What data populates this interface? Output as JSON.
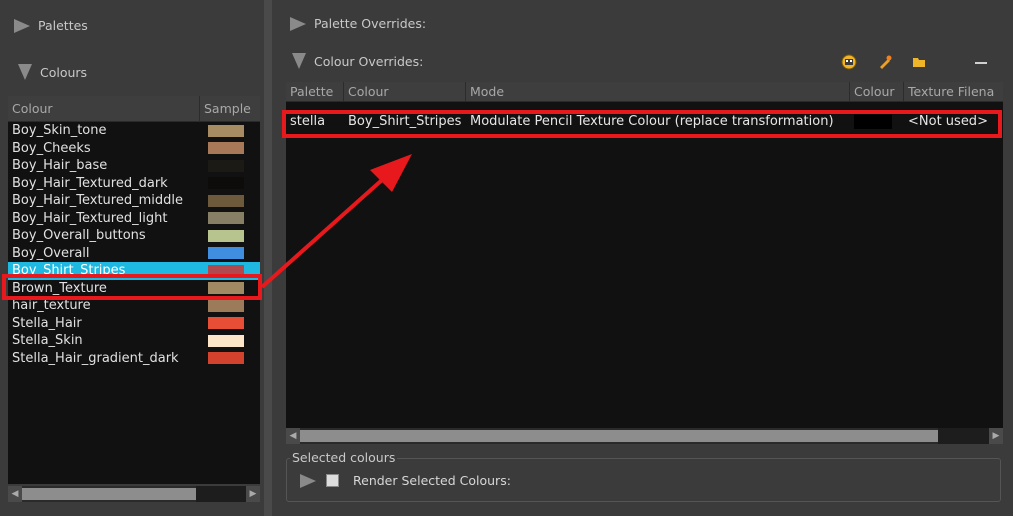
{
  "left": {
    "palettes_label": "Palettes",
    "colours_label": "Colours",
    "table_headers": {
      "colour": "Colour",
      "sample": "Sample"
    },
    "colours": [
      {
        "name": "Boy_Skin_tone",
        "swatch": "#a78b63"
      },
      {
        "name": "Boy_Cheeks",
        "swatch": "#a87958"
      },
      {
        "name": "Boy_Hair_base",
        "swatch": "#1c1a15"
      },
      {
        "name": "Boy_Hair_Textured_dark",
        "swatch": "#0d0c0a"
      },
      {
        "name": "Boy_Hair_Textured_middle",
        "swatch": "#6d5a3d"
      },
      {
        "name": "Boy_Hair_Textured_light",
        "swatch": "#867f65"
      },
      {
        "name": "Boy_Overall_buttons",
        "swatch": "#b8c48e"
      },
      {
        "name": "Boy_Overall",
        "swatch": "#3f8ee0"
      },
      {
        "name": "Boy_Shirt_Stripes",
        "swatch": "#b04a4e",
        "selected": true
      },
      {
        "name": "Brown_Texture",
        "swatch": "#a18a63"
      },
      {
        "name": "hair_texture",
        "swatch": "#9b7b5a"
      },
      {
        "name": "Stella_Hair",
        "swatch": "#e84e35"
      },
      {
        "name": "Stella_Skin",
        "swatch": "#fde5c8"
      },
      {
        "name": "Stella_Hair_gradient_dark",
        "swatch": "#d2422c"
      }
    ]
  },
  "right": {
    "palette_overrides_label": "Palette Overrides:",
    "colour_overrides_label": "Colour Overrides:",
    "table_headers": {
      "palette": "Palette",
      "colour": "Colour",
      "mode": "Mode",
      "colour_swatch": "Colour",
      "texture": "Texture Filena"
    },
    "rows": [
      {
        "palette": "stella",
        "colour": "Boy_Shirt_Stripes",
        "mode": "Modulate Pencil Texture Colour (replace transformation)",
        "swatch": "#000000",
        "texture": "<Not used>"
      }
    ],
    "selected_colours_label": "Selected colours",
    "render_selected_label": "Render Selected Colours:"
  },
  "icons": {
    "palette_settings": "palette-settings-icon",
    "edit": "pencil-edit-icon",
    "folder": "folder-icon",
    "minus": "minus-icon"
  },
  "colors": {
    "selection": "#1fb8e0",
    "highlight_box": "#e8191c",
    "arrow": "#e8191c"
  }
}
